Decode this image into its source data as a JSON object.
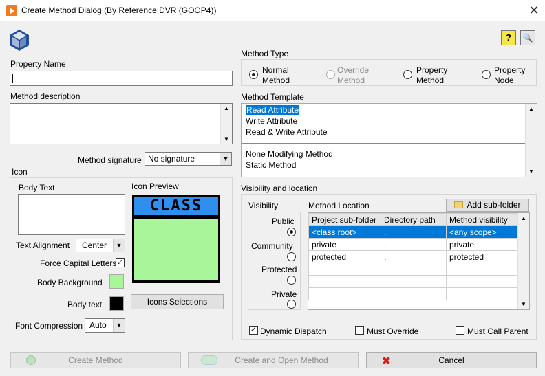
{
  "window": {
    "title": "Create Method Dialog (By Reference DVR (GOOP4))",
    "close_glyph": "✕"
  },
  "toolbar": {
    "help_glyph": "?",
    "zoom_glyph": "🔍"
  },
  "left": {
    "property_name_label": "Property Name",
    "property_name_value": "",
    "method_description_label": "Method description",
    "method_description_value": "",
    "method_signature_label": "Method signature",
    "method_signature_value": "No signature",
    "icon_label": "Icon",
    "body_text_label": "Body Text",
    "body_text_value": "",
    "icon_preview_label": "Icon Preview",
    "icon_preview_header": "CLASS",
    "text_alignment_label": "Text Alignment",
    "text_alignment_value": "Center",
    "force_capital_label": "Force Capital Letters",
    "force_capital_checked": true,
    "body_background_label": "Body Background",
    "body_background_color": "#a8f59a",
    "body_text_color_label": "Body text",
    "body_text_color": "#000000",
    "icons_selections_button": "Icons Selections",
    "font_compression_label": "Font Compression",
    "font_compression_value": "Auto"
  },
  "method_type": {
    "label": "Method Type",
    "options": [
      {
        "line1": "Normal",
        "line2": "Method",
        "checked": true,
        "disabled": false
      },
      {
        "line1": "Override",
        "line2": "Method",
        "checked": false,
        "disabled": true
      },
      {
        "line1": "Property",
        "line2": "Method",
        "checked": false,
        "disabled": false
      },
      {
        "line1": "Property",
        "line2": "Node",
        "checked": false,
        "disabled": false
      }
    ]
  },
  "method_template": {
    "label": "Method Template",
    "items": [
      "Read Attribute",
      "Write Attribute",
      "Read & Write Attribute",
      "None Modifying Method",
      "Static Method"
    ],
    "selected_index": 0
  },
  "visibility": {
    "section_label": "Visibility and location",
    "visibility_label": "Visibility",
    "options": [
      {
        "label": "Public",
        "checked": true
      },
      {
        "label": "Community",
        "checked": false
      },
      {
        "label": "Protected",
        "checked": false
      },
      {
        "label": "Private",
        "checked": false
      }
    ],
    "method_location_label": "Method Location",
    "add_subfolder_button": "Add sub-folder",
    "table": {
      "headers": [
        "Project sub-folder",
        "Directory path",
        "Method visibility"
      ],
      "rows": [
        [
          "<class root>",
          ".",
          "<any scope>"
        ],
        [
          "private",
          ".",
          "private"
        ],
        [
          "protected",
          ".",
          "protected"
        ]
      ],
      "selected_row": 0
    },
    "dynamic_dispatch_label": "Dynamic Dispatch",
    "dynamic_dispatch_checked": true,
    "must_override_label": "Must Override",
    "must_override_checked": false,
    "must_call_parent_label": "Must Call Parent",
    "must_call_parent_checked": false
  },
  "footer": {
    "create_method": "Create Method",
    "create_and_open": "Create and Open Method",
    "cancel": "Cancel"
  }
}
